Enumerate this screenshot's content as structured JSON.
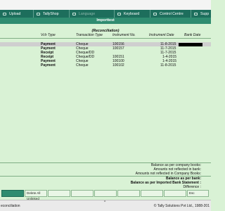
{
  "menu": {
    "items": [
      {
        "label": "Upload",
        "icon": "upload-icon",
        "enabled": true
      },
      {
        "label": "TallyShop",
        "icon": "shop-icon",
        "enabled": true
      },
      {
        "label": "Language",
        "icon": "language-icon",
        "enabled": false
      },
      {
        "label": "Keyboard",
        "icon": "keyboard-icon",
        "enabled": true
      },
      {
        "label": "Control Centre",
        "icon": "control-centre-icon",
        "enabled": true
      },
      {
        "label": "Supp",
        "icon": "support-icon",
        "enabled": true
      }
    ]
  },
  "window": {
    "title": "Importtest"
  },
  "report": {
    "heading": "(Reconciliation)"
  },
  "table": {
    "headers": {
      "vch_type": "Vch Type",
      "transaction_type": "Transaction Type",
      "instrument_no": "Instrument No.",
      "instrument_date": "Instrument Date",
      "bank_date": "Bank Date"
    },
    "rows": [
      {
        "vch_type": "Payment",
        "transaction_type": "Cheque",
        "instrument_no": "100156",
        "instrument_date": "11-8-2015",
        "bank_date": ""
      },
      {
        "vch_type": "Payment",
        "transaction_type": "Cheque",
        "instrument_no": "100157",
        "instrument_date": "11-7-2015",
        "bank_date": ""
      },
      {
        "vch_type": "Receipt",
        "transaction_type": "Cheque/DD",
        "instrument_no": "",
        "instrument_date": "11-7-2015",
        "bank_date": ""
      },
      {
        "vch_type": "Receipt",
        "transaction_type": "Cheque/DD",
        "instrument_no": "100151",
        "instrument_date": "1-4-2015",
        "bank_date": ""
      },
      {
        "vch_type": "Payment",
        "transaction_type": "Cheque",
        "instrument_no": "100100",
        "instrument_date": "1-4-2015",
        "bank_date": ""
      },
      {
        "vch_type": "Payment",
        "transaction_type": "Cheque",
        "instrument_no": "100102",
        "instrument_date": "11-8-2015",
        "bank_date": ""
      }
    ],
    "selected_row": 0
  },
  "summary": {
    "balance_company": "Balance as per company books:",
    "not_reflected_bank": "Amounts not reflected in bank:",
    "not_reflected_company": "Amounts not reflected in Company Books:",
    "balance_bank": "Balance as per bank:",
    "balance_imported": "Balance as per Imported Bank Statement :",
    "difference": "Difference :"
  },
  "buttons": [
    {
      "label": ""
    },
    {
      "label": "Delete All Unlinked"
    },
    {
      "label": ""
    },
    {
      "label": ""
    },
    {
      "label": ""
    },
    {
      "label": ""
    },
    {
      "label": ""
    },
    {
      "label": ""
    },
    {
      "label": "Esc"
    }
  ],
  "status": {
    "left": "econciliation",
    "right": "© Tally Solutions Pvt Ltd., 1988-201",
    "caret": "^"
  },
  "colors": {
    "menubar": "#1d6e5c",
    "titlebar": "#2f8c70",
    "background": "#d9f2d5",
    "selected_row": "#cfcfcf"
  }
}
